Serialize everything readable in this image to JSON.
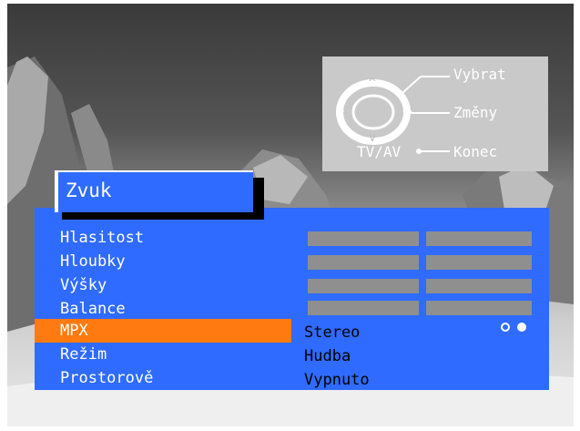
{
  "help": {
    "select_label": "Vybrat",
    "change_label": "Změny",
    "exit_label": "Konec",
    "tvav_label": "TV/AV",
    "minus_symbol": "−",
    "plus_symbol": "+",
    "up_symbol": "^",
    "down_symbol": "v"
  },
  "menu": {
    "title": "Zvuk",
    "items": [
      {
        "label": "Hlasitost"
      },
      {
        "label": "Hloubky"
      },
      {
        "label": "Výšky"
      },
      {
        "label": "Balance"
      },
      {
        "label": "MPX"
      },
      {
        "label": "Režim"
      },
      {
        "label": "Prostorově"
      }
    ],
    "active_item": "MPX",
    "values": {
      "mpx": "Stereo",
      "rezim": "Hudba",
      "prostorove": "Vypnuto"
    }
  },
  "colors": {
    "menu_bg": "#2f6bff",
    "highlight": "#ff7a10",
    "bar": "#8f8f8f",
    "help_panel": "#c9c9c9"
  },
  "icons": [
    "remote-control-dpad-icon",
    "radio-dot-empty-icon",
    "radio-dot-filled-icon"
  ]
}
